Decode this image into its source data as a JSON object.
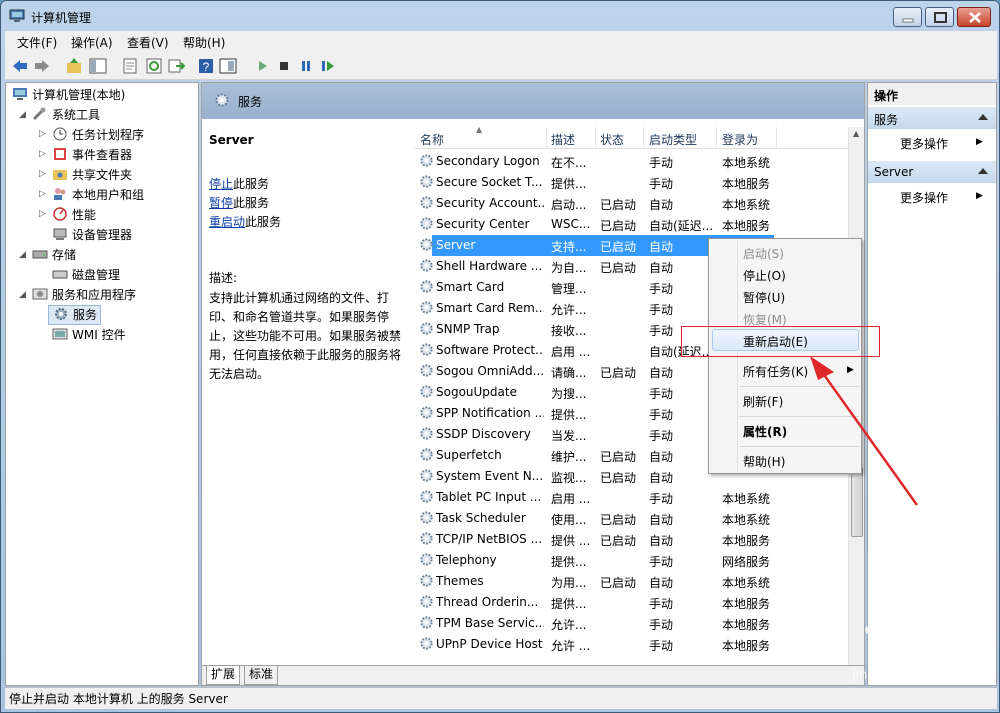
{
  "window": {
    "title": "计算机管理"
  },
  "menubar": [
    "文件(F)",
    "操作(A)",
    "查看(V)",
    "帮助(H)"
  ],
  "tree": {
    "root": "计算机管理(本地)",
    "items": [
      {
        "label": "系统工具"
      },
      {
        "label": "任务计划程序"
      },
      {
        "label": "事件查看器"
      },
      {
        "label": "共享文件夹"
      },
      {
        "label": "本地用户和组"
      },
      {
        "label": "性能"
      },
      {
        "label": "设备管理器"
      },
      {
        "label": "存储"
      },
      {
        "label": "磁盘管理"
      },
      {
        "label": "服务和应用程序"
      },
      {
        "label": "服务"
      },
      {
        "label": "WMI 控件"
      }
    ]
  },
  "center": {
    "header_title": "服务",
    "service_name": "Server",
    "links": [
      {
        "link": "停止",
        "rest": "此服务"
      },
      {
        "link": "暂停",
        "rest": "此服务"
      },
      {
        "link": "重启动",
        "rest": "此服务"
      }
    ],
    "desc_label": "描述:",
    "desc_body": "支持此计算机通过网络的文件、打印、和命名管道共享。如果服务停止，这些功能不可用。如果服务被禁用，任何直接依赖于此服务的服务将无法启动。",
    "columns": [
      "名称",
      "描述",
      "状态",
      "启动类型",
      "登录为"
    ],
    "rows": [
      {
        "name": "Secondary Logon",
        "desc": "在不...",
        "status": "",
        "startup": "手动",
        "logon": "本地系统"
      },
      {
        "name": "Secure Socket T...",
        "desc": "提供...",
        "status": "",
        "startup": "手动",
        "logon": "本地服务"
      },
      {
        "name": "Security Account...",
        "desc": "启动...",
        "status": "已启动",
        "startup": "自动",
        "logon": "本地系统"
      },
      {
        "name": "Security Center",
        "desc": "WSC...",
        "status": "已启动",
        "startup": "自动(延迟...",
        "logon": "本地服务"
      },
      {
        "name": "Server",
        "desc": "支持...",
        "status": "已启动",
        "startup": "自动",
        "logon": ""
      },
      {
        "name": "Shell Hardware ...",
        "desc": "为自...",
        "status": "已启动",
        "startup": "自动",
        "logon": ""
      },
      {
        "name": "Smart Card",
        "desc": "管理...",
        "status": "",
        "startup": "手动",
        "logon": ""
      },
      {
        "name": "Smart Card Rem...",
        "desc": "允许...",
        "status": "",
        "startup": "手动",
        "logon": ""
      },
      {
        "name": "SNMP Trap",
        "desc": "接收...",
        "status": "",
        "startup": "手动",
        "logon": ""
      },
      {
        "name": "Software Protect...",
        "desc": "启用 ...",
        "status": "",
        "startup": "自动(延迟...",
        "logon": ""
      },
      {
        "name": "Sogou OmniAdd...",
        "desc": "请确...",
        "status": "已启动",
        "startup": "自动",
        "logon": ""
      },
      {
        "name": "SogouUpdate",
        "desc": "为搜...",
        "status": "",
        "startup": "手动",
        "logon": ""
      },
      {
        "name": "SPP Notification ...",
        "desc": "提供...",
        "status": "",
        "startup": "手动",
        "logon": ""
      },
      {
        "name": "SSDP Discovery",
        "desc": "当发...",
        "status": "",
        "startup": "手动",
        "logon": ""
      },
      {
        "name": "Superfetch",
        "desc": "维护...",
        "status": "已启动",
        "startup": "自动",
        "logon": ""
      },
      {
        "name": "System Event N...",
        "desc": "监视...",
        "status": "已启动",
        "startup": "自动",
        "logon": ""
      },
      {
        "name": "Tablet PC Input ...",
        "desc": "启用 ...",
        "status": "",
        "startup": "手动",
        "logon": "本地系统"
      },
      {
        "name": "Task Scheduler",
        "desc": "使用...",
        "status": "已启动",
        "startup": "自动",
        "logon": "本地系统"
      },
      {
        "name": "TCP/IP NetBIOS ...",
        "desc": "提供 ...",
        "status": "已启动",
        "startup": "自动",
        "logon": "本地服务"
      },
      {
        "name": "Telephony",
        "desc": "提供...",
        "status": "",
        "startup": "手动",
        "logon": "网络服务"
      },
      {
        "name": "Themes",
        "desc": "为用...",
        "status": "已启动",
        "startup": "自动",
        "logon": "本地系统"
      },
      {
        "name": "Thread Orderin...",
        "desc": "提供...",
        "status": "",
        "startup": "手动",
        "logon": "本地服务"
      },
      {
        "name": "TPM Base Servic...",
        "desc": "允许...",
        "status": "",
        "startup": "手动",
        "logon": "本地服务"
      },
      {
        "name": "UPnP Device Host",
        "desc": "允许 ...",
        "status": "",
        "startup": "手动",
        "logon": "本地服务"
      }
    ],
    "tabs": [
      "扩展",
      "标准"
    ]
  },
  "actions": {
    "title": "操作",
    "sections": [
      {
        "title": "服务",
        "item": "更多操作"
      },
      {
        "title": "Server",
        "item": "更多操作"
      }
    ]
  },
  "context_menu": {
    "items": [
      {
        "label": "启动(S)",
        "state": "disabled"
      },
      {
        "label": "停止(O)",
        "state": "normal"
      },
      {
        "label": "暂停(U)",
        "state": "normal"
      },
      {
        "label": "恢复(M)",
        "state": "disabled"
      },
      {
        "label": "重新启动(E)",
        "state": "highlighted"
      },
      {
        "label": "所有任务(K)",
        "state": "submenu"
      },
      {
        "label": "刷新(F)",
        "state": "normal"
      },
      {
        "label": "属性(R)",
        "state": "bold"
      },
      {
        "label": "帮助(H)",
        "state": "normal"
      }
    ]
  },
  "statusbar": "停止并启动 本地计算机 上的服务 Server",
  "watermark": {
    "brand": "Bai",
    "brand2": "经验",
    "url": "jingyan.baidu.com"
  },
  "colors": {
    "selection": "#3399ff",
    "annotation": "#e0282b",
    "link": "#0a3ea5"
  }
}
